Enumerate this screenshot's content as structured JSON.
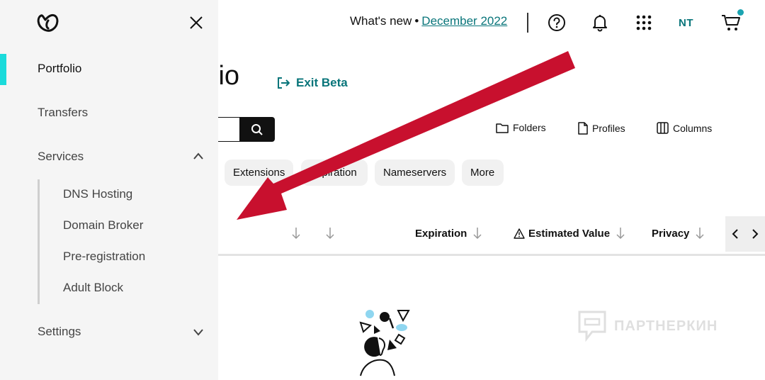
{
  "header": {
    "whats_new_label": "What's new",
    "separator": "•",
    "release_link": "December 2022",
    "user_initials": "NT",
    "icons": [
      "help-icon",
      "bell-icon",
      "apps-grid-icon",
      "cart-icon"
    ],
    "accent_color": "#09757a"
  },
  "page": {
    "title_fragment": "lio",
    "exit_beta_label": "Exit Beta",
    "toolbar": {
      "folders_label": "Folders",
      "profiles_label": "Profiles",
      "columns_label": "Columns"
    },
    "filter_chips": [
      "Extensions",
      "Expiration",
      "Nameservers",
      "More"
    ],
    "columns": {
      "expiration": "Expiration",
      "estimated_value": "Estimated Value",
      "privacy": "Privacy"
    }
  },
  "drawer": {
    "active_color": "#1bdbdb",
    "items": {
      "portfolio": "Portfolio",
      "transfers": "Transfers",
      "services": "Services",
      "settings": "Settings"
    },
    "services_sub": {
      "dns": "DNS Hosting",
      "broker": "Domain Broker",
      "prereg": "Pre-registration",
      "adult": "Adult Block"
    }
  },
  "watermark": {
    "text": "ПАРТНЕРКИН"
  },
  "annotation": {
    "arrow_color": "#c8102e"
  }
}
